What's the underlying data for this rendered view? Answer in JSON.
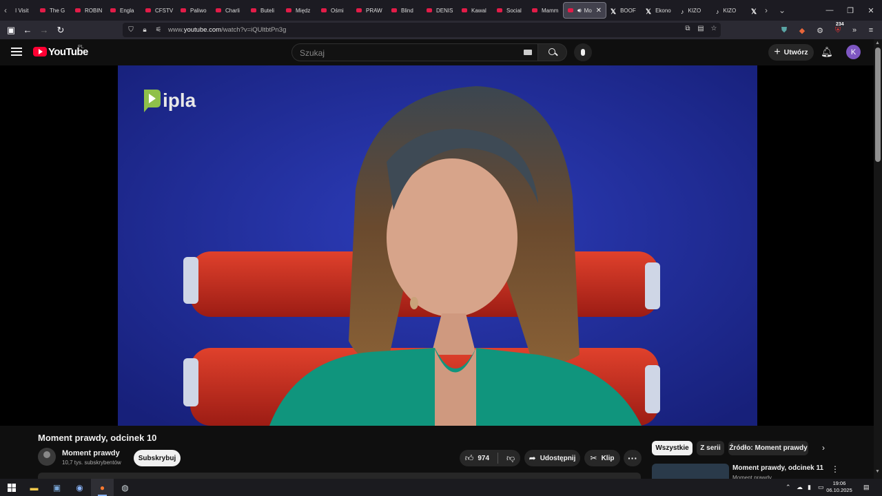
{
  "browser": {
    "tabs": [
      {
        "label": "I Visit",
        "favicon": "plain"
      },
      {
        "label": "The G",
        "favicon": "youtube"
      },
      {
        "label": "ROBIN",
        "favicon": "youtube"
      },
      {
        "label": "Engla",
        "favicon": "youtube"
      },
      {
        "label": "CFSTV",
        "favicon": "youtube"
      },
      {
        "label": "Paliwo",
        "favicon": "youtube"
      },
      {
        "label": "Charli",
        "favicon": "youtube"
      },
      {
        "label": "Buteli",
        "favicon": "youtube"
      },
      {
        "label": "Międz",
        "favicon": "youtube"
      },
      {
        "label": "Ośmi",
        "favicon": "youtube"
      },
      {
        "label": "PRAW",
        "favicon": "youtube"
      },
      {
        "label": "Blind",
        "favicon": "youtube"
      },
      {
        "label": "DENIS",
        "favicon": "youtube"
      },
      {
        "label": "Kawal",
        "favicon": "youtube"
      },
      {
        "label": "Social",
        "favicon": "youtube"
      },
      {
        "label": "Mamm",
        "favicon": "youtube"
      },
      {
        "label": "Mo",
        "favicon": "youtube",
        "active": true,
        "audio": true
      },
      {
        "label": "BOOF",
        "favicon": "x"
      },
      {
        "label": "Ekono",
        "favicon": "x"
      },
      {
        "label": "KIZO",
        "favicon": "tiktok"
      },
      {
        "label": "KIZO",
        "favicon": "tiktok"
      },
      {
        "label": "",
        "favicon": "x"
      }
    ],
    "url_prefix": "www.",
    "url_domain": "youtube.com",
    "url_path": "/watch?v=iQUltbtPn3g",
    "extension_badge": "234"
  },
  "youtube": {
    "logo_text": "YouTube",
    "country": "PL",
    "search_placeholder": "Szukaj",
    "create_label": "Utwórz",
    "avatar_letter": "K",
    "video_watermark": "ipla"
  },
  "video": {
    "title": "Moment prawdy, odcinek 10",
    "channel": "Moment prawdy",
    "subscribers": "10,7 tys. subskrybentów",
    "subscribe_label": "Subskrybuj",
    "likes": "974",
    "share_label": "Udostępnij",
    "clip_label": "Klip",
    "more_label": "···"
  },
  "chips": [
    "Wszystkie",
    "Z serii",
    "Źródło: Moment prawdy"
  ],
  "recommendation": {
    "title": "Moment prawdy, odcinek 11",
    "channel": "Moment prawdy"
  },
  "taskbar": {
    "time": "19:06",
    "date": "06.10.2025"
  },
  "colors": {
    "youtube_red": "#ff0033",
    "avatar_purple": "#7e57c2",
    "studio_blue": "#1f2a8a"
  }
}
